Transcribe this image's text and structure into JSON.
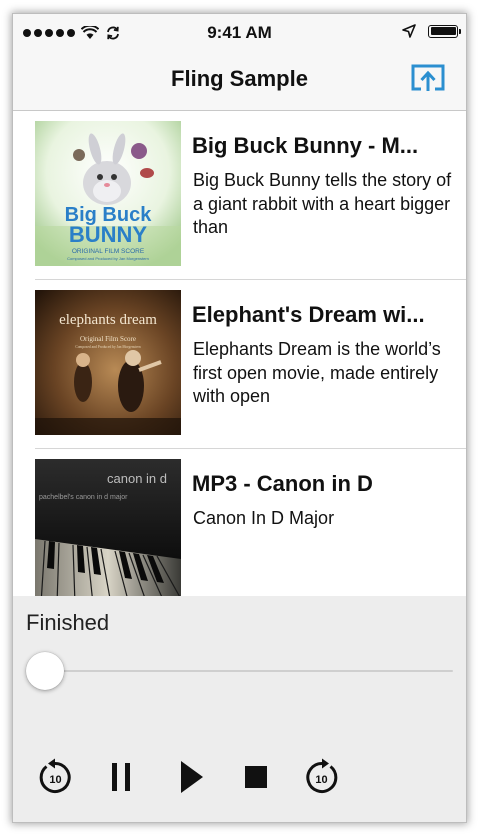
{
  "status_bar": {
    "time": "9:41 AM",
    "icons": [
      "signal-dots-icon",
      "wifi-icon",
      "sync-icon",
      "location-arrow-icon",
      "battery-icon"
    ]
  },
  "nav": {
    "title": "Fling Sample",
    "cast_icon": "airplay-cast-icon",
    "accent_color": "#2b8fd0"
  },
  "media_list": [
    {
      "title": "Big Buck Bunny - M...",
      "description": "Big Buck Bunny tells the story of a giant rabbit with a heart bigger than",
      "thumbnail": {
        "line1": "Big Buck",
        "line2": "BUNNY",
        "caption": "ORIGINAL FILM SCORE",
        "credit": "Composed and Produced by Jan Morgenstern"
      }
    },
    {
      "title": "Elephant's Dream wi...",
      "description": "Elephants Dream is the world’s first open movie, made entirely with open",
      "thumbnail": {
        "line1": "elephants dream",
        "caption": "Original Film Score",
        "credit": "Composed and Produced by Jan Morgenstern"
      }
    },
    {
      "title": "MP3 - Canon in D",
      "description": "Canon In D Major",
      "thumbnail": {
        "line1": "canon in d",
        "line2": "pachelbel's canon in d major"
      }
    }
  ],
  "player": {
    "status": "Finished",
    "progress": 0.0,
    "controls": {
      "rewind_label": "10",
      "forward_label": "10",
      "icons": [
        "rewind-10-icon",
        "pause-icon",
        "play-icon",
        "stop-icon",
        "forward-10-icon"
      ]
    }
  }
}
